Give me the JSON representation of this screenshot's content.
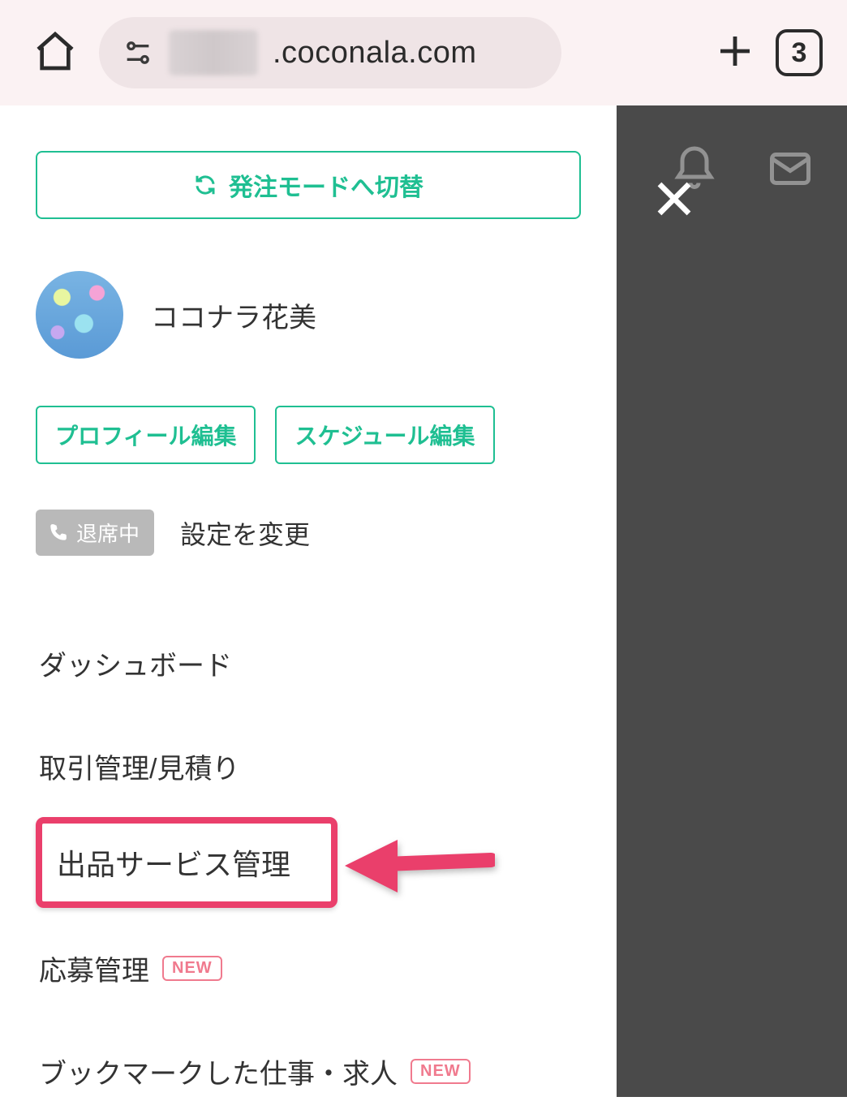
{
  "browser": {
    "url_suffix": ".coconala.com",
    "tab_count": "3"
  },
  "drawer": {
    "switch_mode_label": "発注モードへ切替",
    "user": {
      "name": "ココナラ花美"
    },
    "buttons": {
      "edit_profile": "プロフィール編集",
      "edit_schedule": "スケジュール編集"
    },
    "status": {
      "away_label": "退席中",
      "change_settings": "設定を変更"
    },
    "nav": {
      "dashboard": "ダッシュボード",
      "transactions": "取引管理/見積り",
      "service_mgmt": "出品サービス管理",
      "applications": "応募管理",
      "bookmarked_jobs": "ブックマークした仕事・求人",
      "new_badge": "NEW"
    }
  }
}
